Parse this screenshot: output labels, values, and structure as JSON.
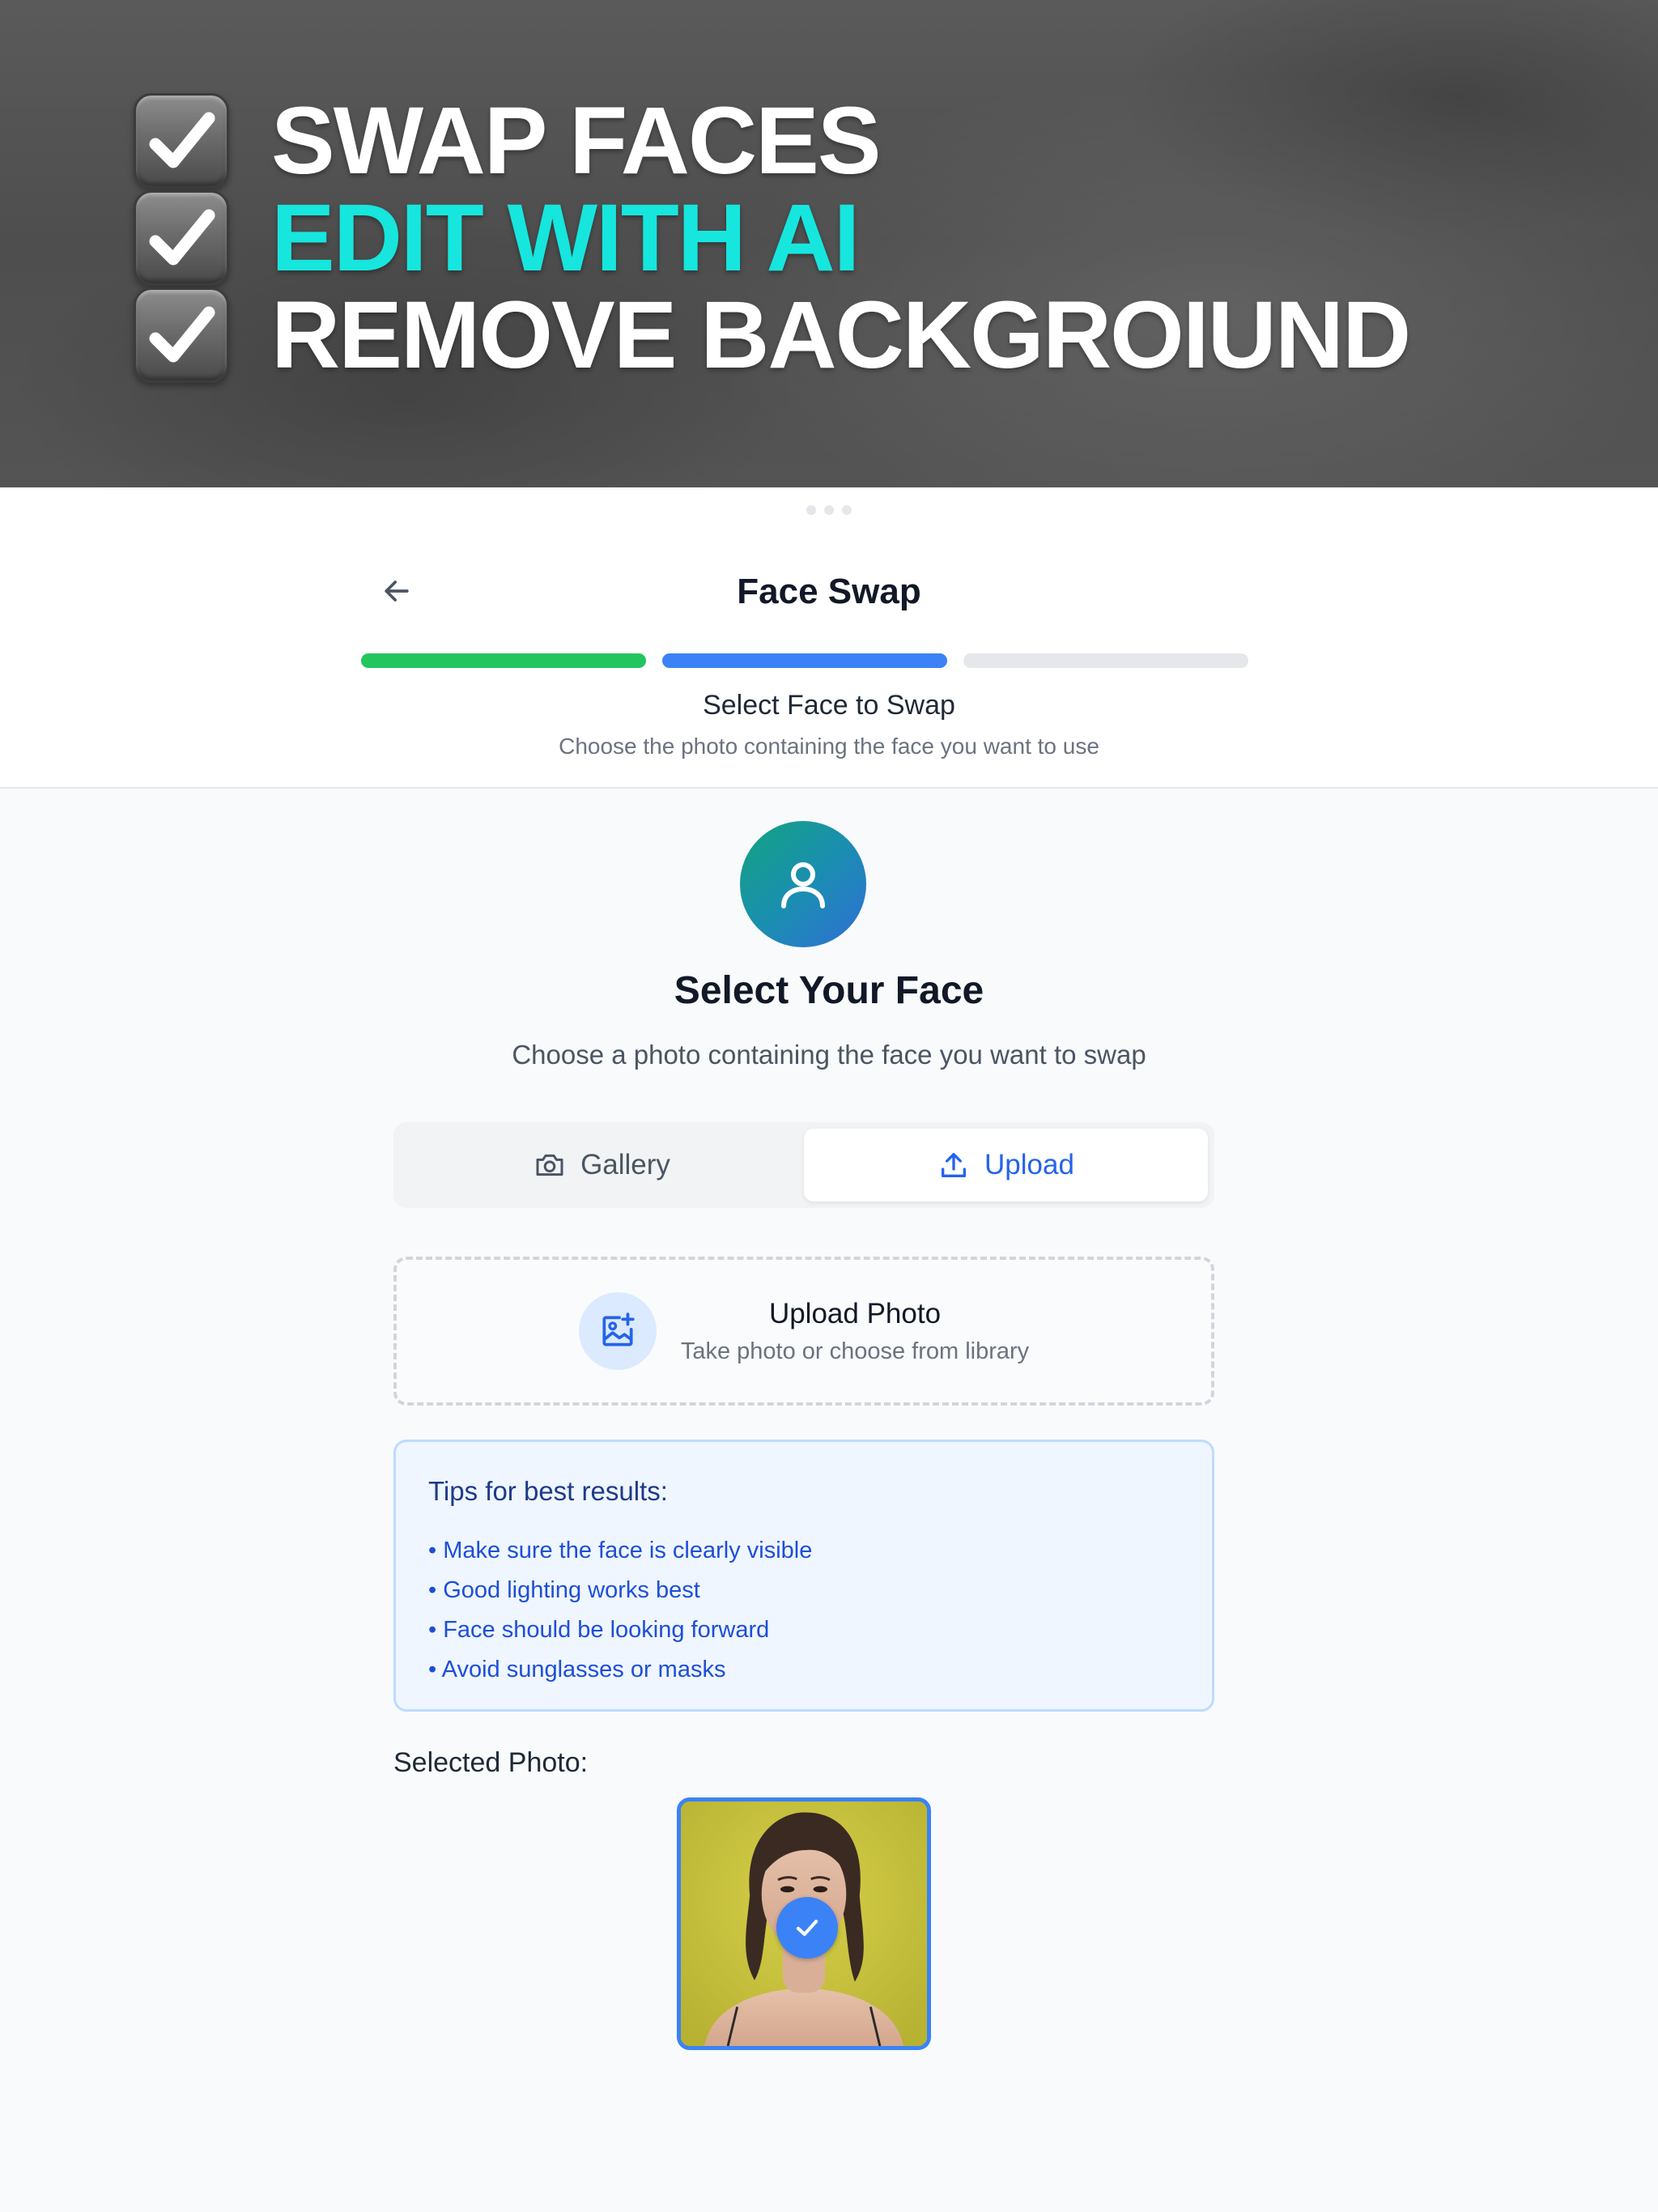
{
  "banner": {
    "lines": [
      {
        "text": "SWAP FACES",
        "color": "#ffffff"
      },
      {
        "text": "EDIT WITH AI",
        "color": "#16e6de"
      },
      {
        "text": "REMOVE BACKGROIUND",
        "color": "#ffffff"
      }
    ]
  },
  "header": {
    "title": "Face Swap",
    "progress": {
      "total_steps": 3,
      "completed": 1,
      "current": 2
    },
    "step_title": "Select Face to Swap",
    "step_subtitle": "Choose the photo containing the face you want to use"
  },
  "main": {
    "icon": "user-icon",
    "title": "Select Your Face",
    "subtitle": "Choose a photo containing the face you want to swap",
    "tabs": [
      {
        "label": "Gallery",
        "icon": "camera-icon",
        "active": false
      },
      {
        "label": "Upload",
        "icon": "upload-icon",
        "active": true
      }
    ],
    "upload": {
      "icon": "image-plus-icon",
      "title": "Upload Photo",
      "subtitle": "Take photo or choose from library"
    },
    "tips": {
      "title": "Tips for best results:",
      "items": [
        "Make sure the face is clearly visible",
        "Good lighting works best",
        "Face should be looking forward",
        "Avoid sunglasses or masks"
      ]
    },
    "selected_label": "Selected Photo:"
  },
  "colors": {
    "accent": "#3b82f6",
    "progress_done": "#22c55e",
    "progress_active": "#3b82f6",
    "banner_accent": "#16e6de"
  }
}
